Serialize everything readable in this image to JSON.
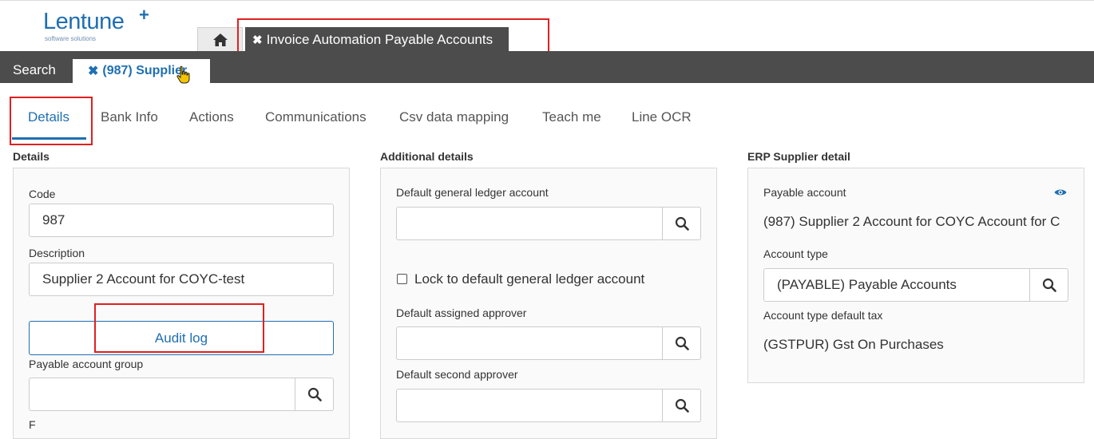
{
  "brand": {
    "logo_text": "Lentune",
    "logo_plus": "+",
    "logo_sub": "software solutions"
  },
  "top_tabs": {
    "home_icon": "home-icon",
    "app_close": "✖",
    "app_tab_label": "Invoice Automation Payable Accounts"
  },
  "sub_bar": {
    "search_label": "Search",
    "record_close": "✖",
    "record_tab_label": "(987) Supplier"
  },
  "nav_tabs": [
    {
      "label": "Details",
      "active": true
    },
    {
      "label": "Bank Info"
    },
    {
      "label": "Actions"
    },
    {
      "label": "Communications"
    },
    {
      "label": "Csv data mapping"
    },
    {
      "label": "Teach me"
    },
    {
      "label": "Line OCR"
    }
  ],
  "details": {
    "title": "Details",
    "code_label": "Code",
    "code_value": "987",
    "description_label": "Description",
    "description_value": "Supplier 2 Account for COYC-test",
    "audit_log_label": "Audit log",
    "payable_group_label": "Payable account group",
    "payable_group_value": "",
    "next_label_partial": "F"
  },
  "additional": {
    "title": "Additional details",
    "default_gl_label": "Default general ledger account",
    "default_gl_value": "",
    "lock_label": "Lock to default general ledger account",
    "lock_checked": false,
    "assigned_approver_label": "Default assigned approver",
    "assigned_approver_value": "",
    "second_approver_label": "Default second approver",
    "second_approver_value": ""
  },
  "erp": {
    "title": "ERP Supplier detail",
    "payable_account_label": "Payable account",
    "payable_account_value": "(987) Supplier 2 Account for COYC Account for C",
    "account_type_label": "Account type",
    "account_type_value": "(PAYABLE) Payable Accounts",
    "default_tax_label": "Account type default tax",
    "default_tax_value": "(GSTPUR) Gst On Purchases"
  },
  "colors": {
    "accent": "#1f6fb2",
    "dark_bar": "#4c4c4c",
    "annotation_red": "#e02020"
  }
}
